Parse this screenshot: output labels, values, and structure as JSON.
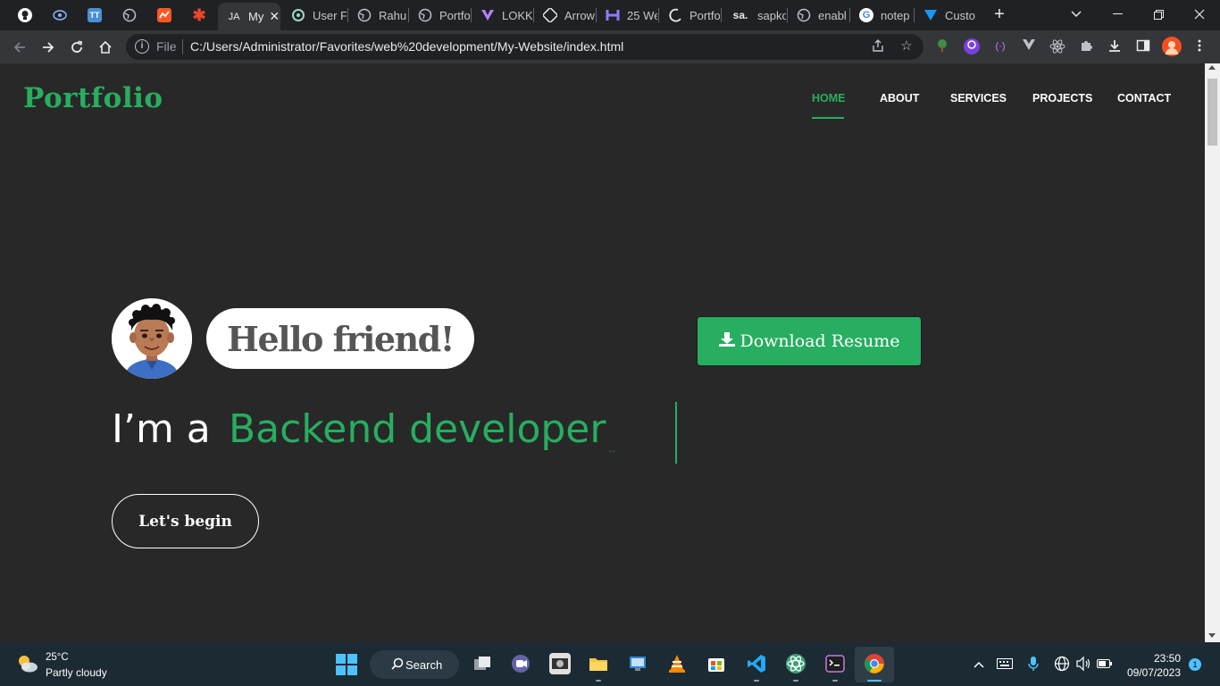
{
  "browser": {
    "tabs": [
      {
        "label": "",
        "favicon": "bulb-icon"
      },
      {
        "label": "",
        "favicon": "eye-icon"
      },
      {
        "label": "",
        "favicon": "tt-icon"
      },
      {
        "label": "",
        "favicon": "globe-icon"
      },
      {
        "label": "",
        "favicon": "chart-icon"
      },
      {
        "label": "",
        "favicon": "asterisk-icon"
      },
      {
        "label": "My",
        "favicon": "ja-icon"
      },
      {
        "label": "User F",
        "favicon": "openai-icon"
      },
      {
        "label": "Rahul",
        "favicon": "globe-icon"
      },
      {
        "label": "Portfo",
        "favicon": "globe-icon"
      },
      {
        "label": "LOKKI",
        "favicon": "lokki-icon"
      },
      {
        "label": "Arrow",
        "favicon": "codepen-icon"
      },
      {
        "label": "25 We",
        "favicon": "h-icon"
      },
      {
        "label": "Portfo",
        "favicon": "moon-icon"
      },
      {
        "label": "sapko",
        "favicon": "sa-icon"
      },
      {
        "label": "enabl",
        "favicon": "globe-icon"
      },
      {
        "label": "notep",
        "favicon": "google-icon"
      },
      {
        "label": "Custo",
        "favicon": "vuetify-icon"
      }
    ],
    "tab_ja_text": "JA",
    "tab_sa_text": "sa.",
    "tab_tt_text": "TT",
    "address": {
      "scheme_label": "File",
      "url": "C:/Users/Administrator/Favorites/web%20development/My-Website/index.html"
    }
  },
  "site": {
    "logo": "Portfolio",
    "nav": [
      {
        "label": "HOME",
        "active": true
      },
      {
        "label": "ABOUT",
        "active": false
      },
      {
        "label": "SERVICES",
        "active": false
      },
      {
        "label": "PROJECTS",
        "active": false
      },
      {
        "label": "CONTACT",
        "active": false
      }
    ],
    "hero": {
      "greeting": "Hello friend!",
      "download_label": "Download Resume",
      "intro": "I’m a",
      "role": "Backend developer",
      "typing_dots": "..",
      "cta_label": "Let's begin"
    },
    "colors": {
      "accent": "#27ae60",
      "background": "#282828"
    }
  },
  "taskbar": {
    "weather": {
      "temp": "25°C",
      "desc": "Partly cloudy"
    },
    "search_label": "Search",
    "clock": {
      "time": "23:50",
      "date": "09/07/2023"
    },
    "notification_count": "1"
  }
}
